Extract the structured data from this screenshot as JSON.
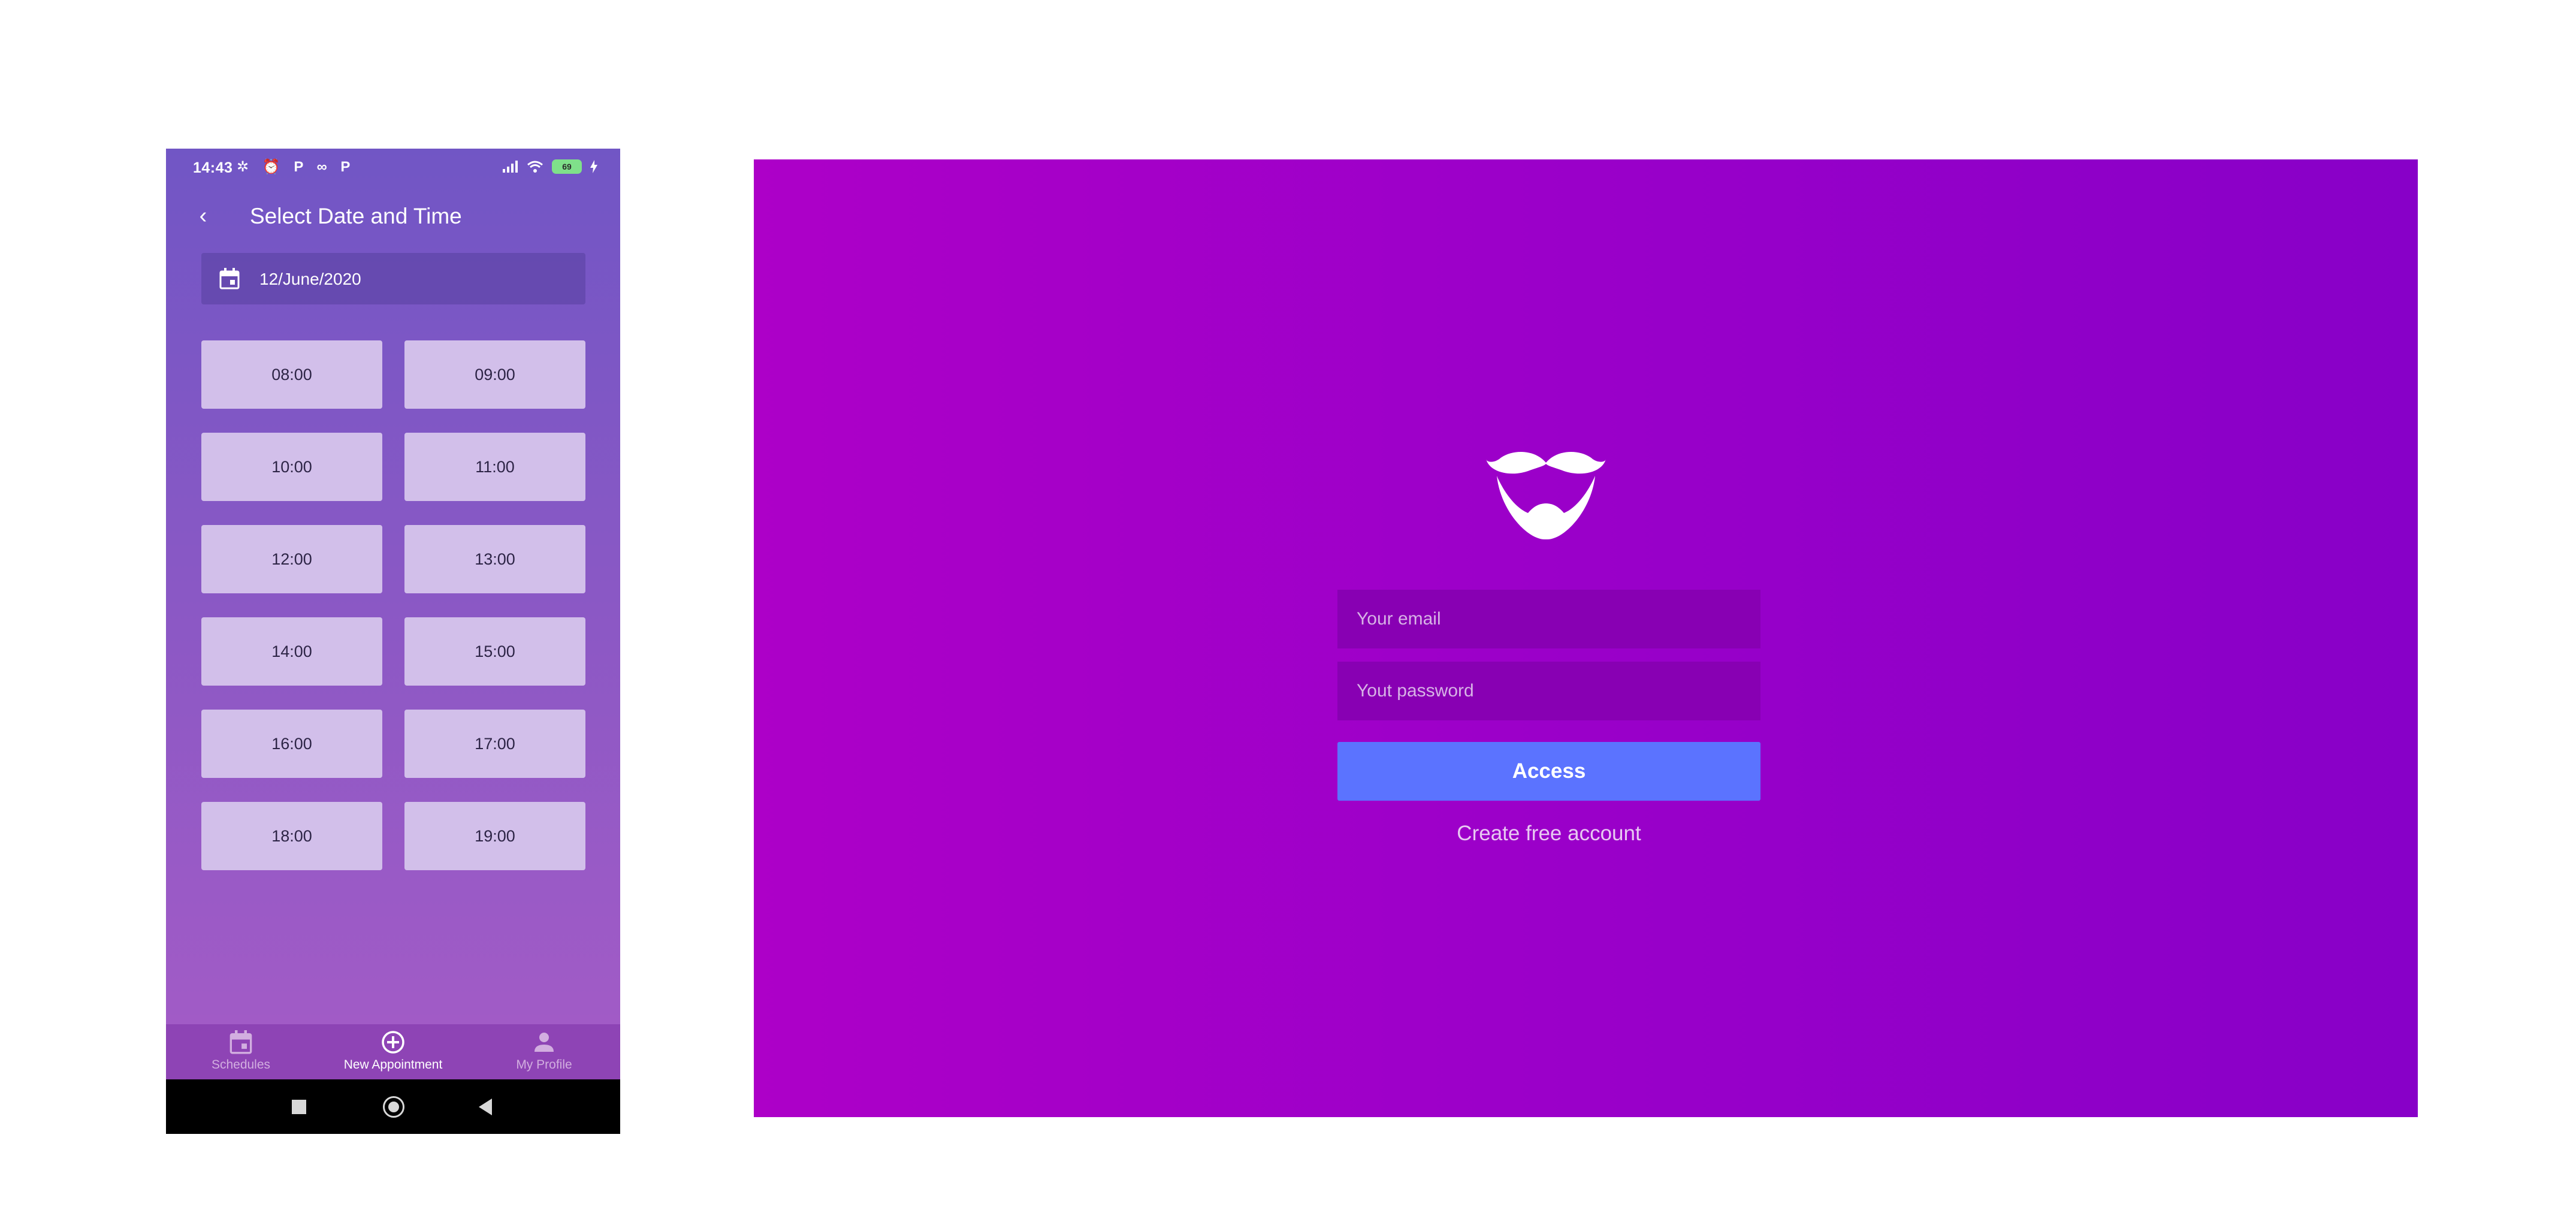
{
  "mobile": {
    "status_bar": {
      "time": "14:43",
      "icons": "✲ ⏰ P ∞ P",
      "battery": "69"
    },
    "header": {
      "back_icon": "chevron-left-icon",
      "title": "Select Date and Time"
    },
    "date_picker": {
      "icon": "calendar-icon",
      "value": "12/June/2020"
    },
    "time_slots": [
      "08:00",
      "09:00",
      "10:00",
      "11:00",
      "12:00",
      "13:00",
      "14:00",
      "15:00",
      "16:00",
      "17:00",
      "18:00",
      "19:00"
    ],
    "bottom_nav": [
      {
        "label": "Schedules",
        "icon": "calendar-icon",
        "active": false
      },
      {
        "label": "New Appointment",
        "icon": "plus-circle-icon",
        "active": true
      },
      {
        "label": "My Profile",
        "icon": "person-icon",
        "active": false
      }
    ],
    "colors": {
      "slot_bg": "#d2bfea",
      "gradient_top": "#7156c5",
      "gradient_bottom": "#a75cc6"
    }
  },
  "web_login": {
    "logo": "mustache-logo",
    "email_placeholder": "Your email",
    "password_placeholder": "Yout password",
    "access_label": "Access",
    "create_account_label": "Create free account",
    "colors": {
      "bg_left": "#ad00c8",
      "bg_right": "#8800c8",
      "button": "#5b73ff",
      "input_bg": "#8800b3"
    }
  }
}
